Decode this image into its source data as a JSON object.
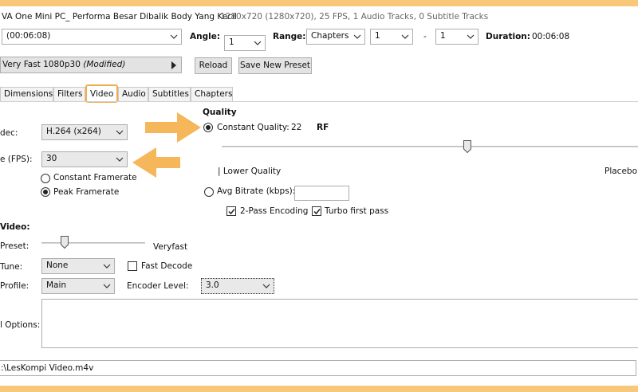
{
  "header": {
    "title": "VA One Mini PC_ Performa Besar Dibalik Body Yang Kecil",
    "source_info": "1280x720 (1280x720), 25 FPS, 1 Audio Tracks, 0 Subtitle Tracks"
  },
  "source_row": {
    "title_select": "(00:06:08)",
    "angle_label": "Angle:",
    "angle_value": "1",
    "range_label": "Range:",
    "range_type": "Chapters",
    "range_start": "1",
    "range_sep": "-",
    "range_end": "1",
    "duration_label": "Duration:",
    "duration_value": "00:06:08"
  },
  "preset_row": {
    "preset_name": "Very Fast 1080p30",
    "preset_modified": "(Modified)",
    "reload_label": "Reload",
    "save_preset_label": "Save New Preset"
  },
  "tabs": [
    {
      "label": "Dimensions"
    },
    {
      "label": "Filters"
    },
    {
      "label": "Video"
    },
    {
      "label": "Audio"
    },
    {
      "label": "Subtitles"
    },
    {
      "label": "Chapters"
    }
  ],
  "video": {
    "codec_label": "dec:",
    "codec_value": "H.264 (x264)",
    "fps_label": "e (FPS):",
    "fps_value": "30",
    "constant_framerate_label": "Constant Framerate",
    "peak_framerate_label": "Peak Framerate",
    "framerate_mode_selected": "peak"
  },
  "quality": {
    "heading": "Quality",
    "constant_quality_label": "Constant Quality:",
    "constant_quality_value": "22",
    "constant_quality_unit": "RF",
    "lower_quality_label": "| Lower Quality",
    "placebo_label": "Placebo",
    "avg_bitrate_label": "Avg Bitrate (kbps):",
    "avg_bitrate_value": "",
    "two_pass_label": "2-Pass Encoding",
    "turbo_label": "Turbo first pass",
    "two_pass_checked": true,
    "turbo_checked": true,
    "mode_selected": "constant_quality",
    "quality_slider_fraction": 0.59
  },
  "encoder": {
    "section_label": "Video:",
    "preset_label": "Preset:",
    "preset_value": "Veryfast",
    "preset_slider_fraction": 0.22,
    "tune_label": "Tune:",
    "tune_value": "None",
    "fast_decode_label": "Fast Decode",
    "fast_decode_checked": false,
    "profile_label": "Profile:",
    "profile_value": "Main",
    "level_label": "Encoder Level:",
    "level_value": "3.0",
    "options_label": "l Options:",
    "options_value": ""
  },
  "destination": {
    "path": ":\\LesKompi Video.m4v"
  },
  "colors": {
    "accent_frame": "#f7c77a",
    "highlight_arrow": "#f5b759",
    "active_tab_border": "#f0ad4e"
  }
}
